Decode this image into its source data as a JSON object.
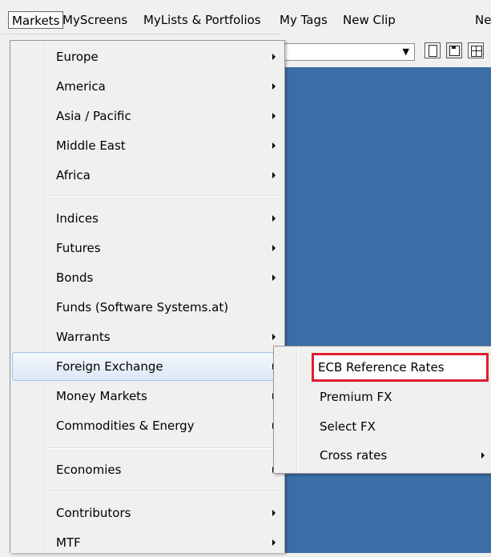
{
  "menubar": {
    "items": [
      "Markets",
      "MyScreens",
      "MyLists & Portfolios",
      "My Tags",
      "New Clip",
      "Ne"
    ]
  },
  "toolbar": {
    "combo_value": "",
    "icons": [
      "new-document-icon",
      "save-icon",
      "grid-icon"
    ]
  },
  "markets_menu": {
    "groups": [
      [
        "Europe",
        "America",
        "Asia / Pacific",
        "Middle East",
        "Africa"
      ],
      [
        "Indices",
        "Futures",
        "Bonds",
        "Funds (Software Systems.at)",
        "Warrants",
        "Foreign Exchange",
        "Money Markets",
        "Commodities & Energy"
      ],
      [
        "Economies"
      ],
      [
        "Contributors",
        "MTF"
      ]
    ],
    "highlighted": "Foreign Exchange"
  },
  "fx_submenu": {
    "items": [
      "ECB Reference Rates",
      "Premium FX",
      "Select FX",
      "Cross rates"
    ],
    "focused": "ECB Reference Rates",
    "focus_color": "#e01e2d"
  },
  "colors": {
    "workspace": "#3b6ea6",
    "menu_bg": "#f0f0f0",
    "highlight_border": "#a9c2e4"
  }
}
